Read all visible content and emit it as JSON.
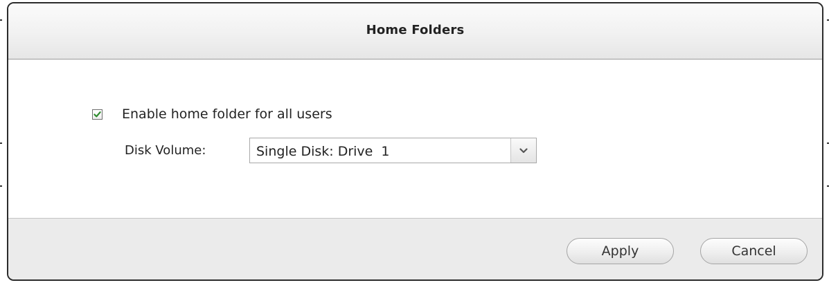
{
  "dialog": {
    "title": "Home Folders"
  },
  "home_folder": {
    "enable_label": "Enable home folder for all users",
    "enabled": true,
    "disk_volume_label": "Disk Volume:",
    "disk_volume_value": "Single Disk: Drive  1"
  },
  "footer": {
    "apply_label": "Apply",
    "cancel_label": "Cancel"
  },
  "icons": {
    "checkbox_check": "check-icon",
    "dropdown": "chevron-down-icon"
  },
  "colors": {
    "check_mark": "#2e8b2e",
    "footer_bg": "#ebebeb",
    "dialog_border": "#2b2b2b"
  }
}
